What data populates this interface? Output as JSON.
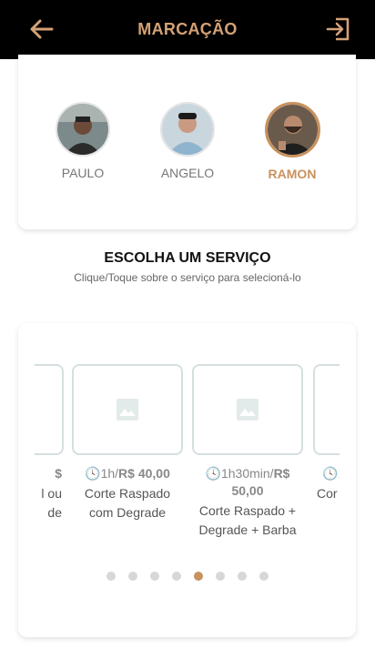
{
  "header": {
    "title": "MARCAÇÃO",
    "back_icon": "arrow-left-icon",
    "exit_icon": "logout-icon",
    "accent": "#d4a276"
  },
  "barbers": [
    {
      "name": "PAULO",
      "selected": false
    },
    {
      "name": "ANGELO",
      "selected": false
    },
    {
      "name": "RAMON",
      "selected": true
    }
  ],
  "section": {
    "title": "ESCOLHA UM SERVIÇO",
    "subtitle": "Clique/Toque sobre o serviço para selecioná-lo"
  },
  "services": [
    {
      "price_text": "$",
      "desc_lines": [
        "l ou",
        "de"
      ]
    },
    {
      "duration": "1h/",
      "price": "R$ 40,00",
      "price2": "",
      "desc_lines": [
        "Corte Raspado",
        "com Degrade"
      ]
    },
    {
      "duration": "1h30min/",
      "price": "R$",
      "price2": "50,00",
      "desc_lines": [
        "Corte Raspado +",
        "Degrade + Barba"
      ]
    },
    {
      "duration": "1",
      "desc_lines": [
        "Cor"
      ]
    }
  ],
  "pagination": {
    "count": 8,
    "active_index": 4
  },
  "colors": {
    "accent": "#c8925e",
    "dot": "#d7d7d7"
  }
}
